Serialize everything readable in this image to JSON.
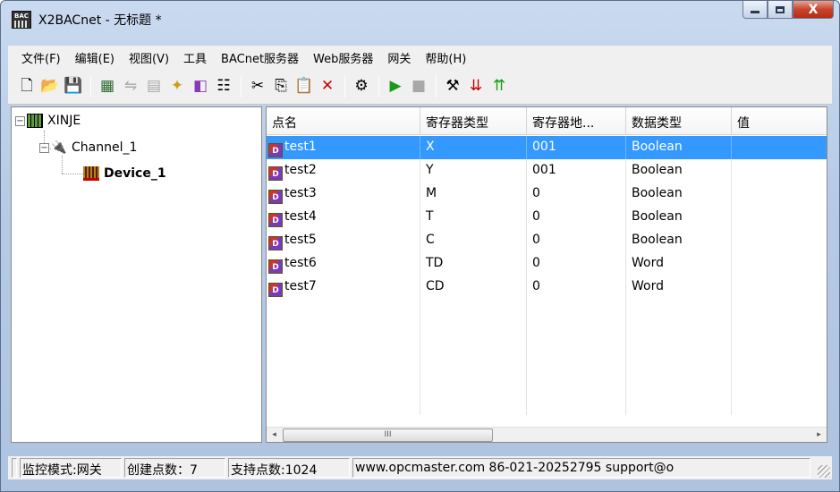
{
  "window": {
    "title": "X2BACnet - 无标题 *",
    "icon_label": "BAC",
    "close_glyph": "X"
  },
  "menu": {
    "items": [
      "文件(F)",
      "编辑(E)",
      "视图(V)",
      "工具",
      "BACnet服务器",
      "Web服务器",
      "网关",
      "帮助(H)"
    ]
  },
  "toolbar": {
    "icons": [
      "new-file-icon",
      "open-folder-icon",
      "save-icon",
      "add-device-icon",
      "add-channel-icon",
      "add-group-icon",
      "new-item-icon",
      "add-point-icon",
      "properties-icon",
      "cut-icon",
      "copy-icon",
      "paste-icon",
      "delete-icon",
      "import-icon",
      "run-icon",
      "stop-icon",
      "tools-icon",
      "load-icon",
      "upload-icon"
    ]
  },
  "tree": {
    "root": "XINJE",
    "channel": "Channel_1",
    "device": "Device_1",
    "expander_minus": "−"
  },
  "list": {
    "columns": [
      "点名",
      "寄存器类型",
      "寄存器地...",
      "数据类型",
      "值"
    ],
    "rows": [
      {
        "name": "test1",
        "reg_type": "X",
        "reg_addr": "001",
        "data_type": "Boolean",
        "value": "",
        "selected": true
      },
      {
        "name": "test2",
        "reg_type": "Y",
        "reg_addr": "001",
        "data_type": "Boolean",
        "value": ""
      },
      {
        "name": "test3",
        "reg_type": "M",
        "reg_addr": "0",
        "data_type": "Boolean",
        "value": ""
      },
      {
        "name": "test4",
        "reg_type": "T",
        "reg_addr": "0",
        "data_type": "Boolean",
        "value": ""
      },
      {
        "name": "test5",
        "reg_type": "C",
        "reg_addr": "0",
        "data_type": "Boolean",
        "value": ""
      },
      {
        "name": "test6",
        "reg_type": "TD",
        "reg_addr": "0",
        "data_type": "Word",
        "value": ""
      },
      {
        "name": "test7",
        "reg_type": "CD",
        "reg_addr": "0",
        "data_type": "Word",
        "value": ""
      }
    ],
    "icon_label": "D",
    "scroll_left": "◂",
    "scroll_right": "▸",
    "scroll_thumb": "III"
  },
  "status": {
    "first": "",
    "mode": "监控模式:网关",
    "points_created": "创建点数：7",
    "points_supported": "支持点数:1024",
    "contact": "www.opcmaster.com 86-021-20252795 support@o"
  },
  "colors": {
    "selection": "#3399ff",
    "titlebar": "#b7cbe6",
    "close_button": "#c8442c"
  }
}
